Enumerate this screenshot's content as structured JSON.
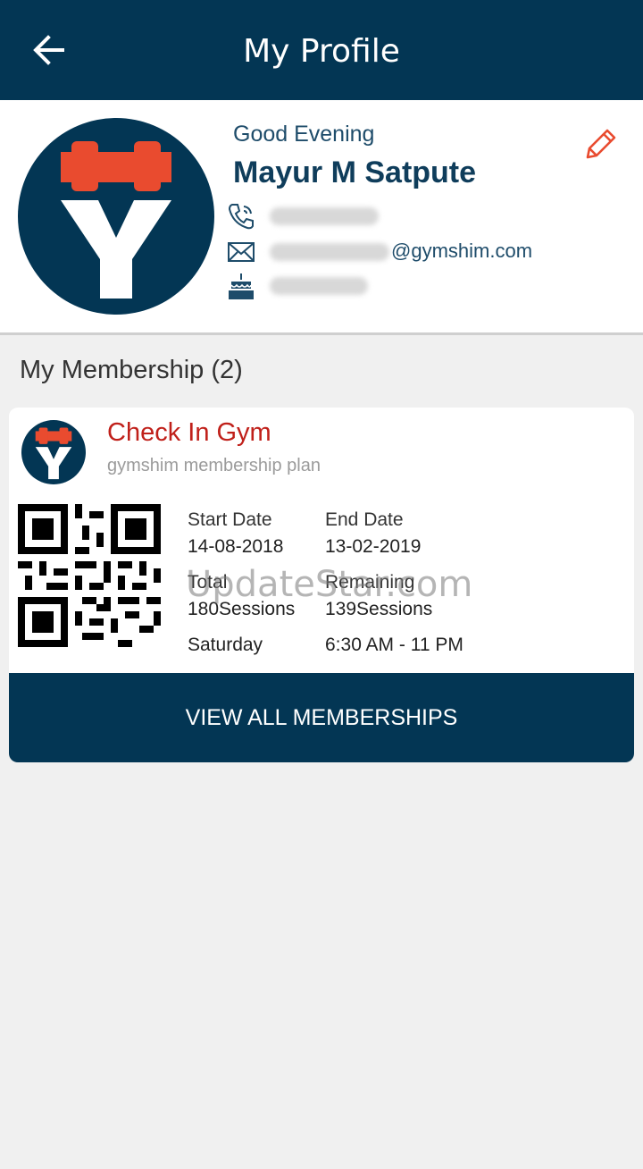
{
  "header": {
    "title": "My Profile",
    "back_icon": "arrow-left-icon"
  },
  "profile": {
    "greeting": "Good Evening",
    "name": "Mayur M Satpute",
    "email_domain": "@gymshim.com",
    "icons": [
      "phone-icon",
      "mail-icon",
      "cake-icon",
      "pencil-icon"
    ],
    "logo_letter": "Y"
  },
  "membership": {
    "section_title": "My Membership (2)",
    "card": {
      "gym_name": "Check In Gym",
      "plan": "gymshim membership plan",
      "start_label": "Start Date",
      "start_value": "14-08-2018",
      "end_label": "End Date",
      "end_value": "13-02-2019",
      "total_label": "Total",
      "total_value": "180Sessions",
      "remaining_label": "Remaining",
      "remaining_value": "139Sessions",
      "day": "Saturday",
      "time": "6:30 AM - 11 PM"
    },
    "view_all_label": "VIEW ALL MEMBERSHIPS"
  },
  "watermark": "UpdateStar.com",
  "colors": {
    "primary": "#033654",
    "accent": "#e94b2f",
    "gym_name": "#c0201a"
  }
}
